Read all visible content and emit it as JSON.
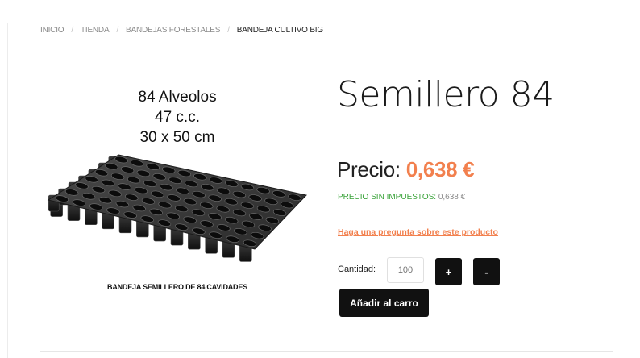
{
  "breadcrumb": {
    "items": [
      "INICIO",
      "TIENDA",
      "BANDEJAS FORESTALES"
    ],
    "current": "BANDEJA CULTIVO BIG",
    "separator": "/"
  },
  "product": {
    "image_lines": [
      "84 Alveolos",
      "47 c.c.",
      "30 x 50 cm"
    ],
    "image_caption": "BANDEJA SEMILLERO DE 84 CAVIDADES",
    "title": "Semillero 84",
    "price_label": "Precio:",
    "price_value": "0,638 €",
    "tax_label": "PRECIO SIN IMPUESTOS:",
    "tax_value": "0,638 €",
    "ask_link": "Haga una pregunta sobre este producto",
    "quantity_label": "Cantidad:",
    "quantity_placeholder": "100",
    "plus_label": "+",
    "minus_label": "-",
    "add_to_cart": "Añadir al carro"
  },
  "colors": {
    "accent": "#f2804e",
    "tax_green": "#3aa33a",
    "button": "#111111"
  }
}
